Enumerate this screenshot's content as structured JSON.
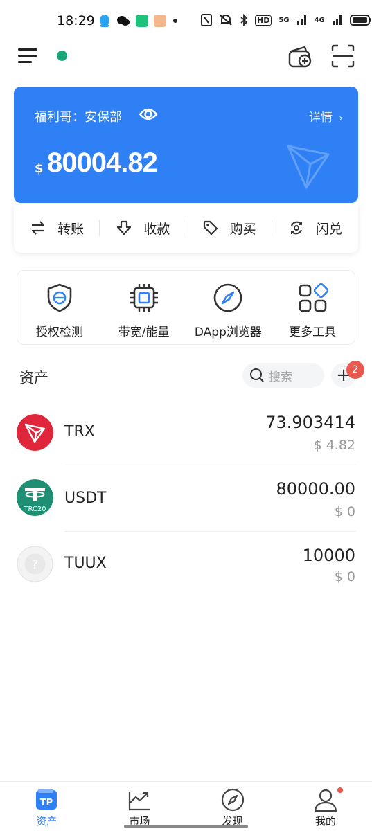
{
  "status_bar": {
    "time": "18:29",
    "network_5g": "5G",
    "network_4g": "4G",
    "hd": "HD"
  },
  "wallet_card": {
    "wallet_name": "福利哥：安保部",
    "detail_label": "详情",
    "currency_symbol": "$",
    "balance": "80004.82",
    "accent_color": "#2f80f5"
  },
  "actions": [
    {
      "label": "转账",
      "icon": "transfer-icon"
    },
    {
      "label": "收款",
      "icon": "receive-icon"
    },
    {
      "label": "购买",
      "icon": "buy-tag-icon"
    },
    {
      "label": "闪兑",
      "icon": "swap-icon"
    }
  ],
  "tools": [
    {
      "label": "授权检测",
      "icon": "shield-icon"
    },
    {
      "label": "带宽/能量",
      "icon": "chip-icon"
    },
    {
      "label": "DApp浏览器",
      "icon": "compass-icon"
    },
    {
      "label": "更多工具",
      "icon": "grid-icon"
    }
  ],
  "assets": {
    "title": "资产",
    "search_placeholder": "搜索",
    "add_badge_count": "2",
    "tokens": [
      {
        "symbol": "TRX",
        "balance": "73.903414",
        "value": "$ 4.82",
        "logo_color": "#e0263a"
      },
      {
        "symbol": "USDT",
        "balance": "80000.00",
        "value": "$ 0",
        "logo_color": "#1f8f74",
        "logo_tag": "TRC20"
      },
      {
        "symbol": "TUUX",
        "balance": "10000",
        "value": "$ 0",
        "logo_color": "#eeeeee"
      }
    ]
  },
  "bottom_nav": [
    {
      "label": "资产",
      "icon": "tp-wallet-icon",
      "active": true
    },
    {
      "label": "市场",
      "icon": "market-chart-icon",
      "active": false
    },
    {
      "label": "发现",
      "icon": "compass-icon",
      "active": false
    },
    {
      "label": "我的",
      "icon": "user-icon",
      "active": false
    }
  ]
}
